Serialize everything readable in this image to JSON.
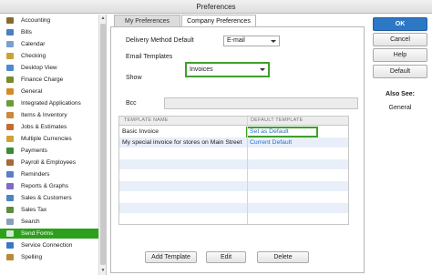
{
  "window": {
    "title": "Preferences"
  },
  "sidebar": {
    "items": [
      {
        "label": "Accounting",
        "color": "#8a6a2c"
      },
      {
        "label": "Bills",
        "color": "#4a7fbf"
      },
      {
        "label": "Calendar",
        "color": "#7aa0cf"
      },
      {
        "label": "Checking",
        "color": "#c9a23a"
      },
      {
        "label": "Desktop View",
        "color": "#4f8bd0"
      },
      {
        "label": "Finance Charge",
        "color": "#7b8a2b"
      },
      {
        "label": "General",
        "color": "#d38b2a"
      },
      {
        "label": "Integrated Applications",
        "color": "#6b9b3a"
      },
      {
        "label": "Items & Inventory",
        "color": "#c98a3c"
      },
      {
        "label": "Jobs & Estimates",
        "color": "#c96a2a"
      },
      {
        "label": "Multiple Currencies",
        "color": "#caa531"
      },
      {
        "label": "Payments",
        "color": "#3b8b3b"
      },
      {
        "label": "Payroll & Employees",
        "color": "#a5693a"
      },
      {
        "label": "Reminders",
        "color": "#5b7ec8"
      },
      {
        "label": "Reports & Graphs",
        "color": "#7e6cc4"
      },
      {
        "label": "Sales & Customers",
        "color": "#4b86c3"
      },
      {
        "label": "Sales Tax",
        "color": "#5e8c3d"
      },
      {
        "label": "Search",
        "color": "#8aa0b8"
      },
      {
        "label": "Send Forms",
        "color": "#d0e8d0"
      },
      {
        "label": "Service Connection",
        "color": "#3a79c2"
      },
      {
        "label": "Spelling",
        "color": "#b88a3a"
      }
    ]
  },
  "tabs": [
    {
      "label": "My Preferences"
    },
    {
      "label": "Company Preferences"
    }
  ],
  "form": {
    "delivery_method_label": "Delivery Method Default",
    "delivery_method_value": "E-mail",
    "email_templates_label": "Email Templates",
    "show_label": "Show",
    "show_value": "Invoices",
    "bcc_label": "Bcc"
  },
  "table": {
    "columns": [
      "TEMPLATE NAME",
      "DEFAULT TEMPLATE"
    ],
    "rows": [
      {
        "name": "Basic Invoice",
        "default": "Set as Default"
      },
      {
        "name": "My special invoice for stores on Main Street",
        "default": "Current Default"
      }
    ]
  },
  "buttons": {
    "add_template": "Add Template",
    "edit": "Edit",
    "delete": "Delete"
  },
  "right_panel": {
    "ok": "OK",
    "cancel": "Cancel",
    "help": "Help",
    "default": "Default",
    "also_see": "Also See:",
    "general": "General"
  }
}
